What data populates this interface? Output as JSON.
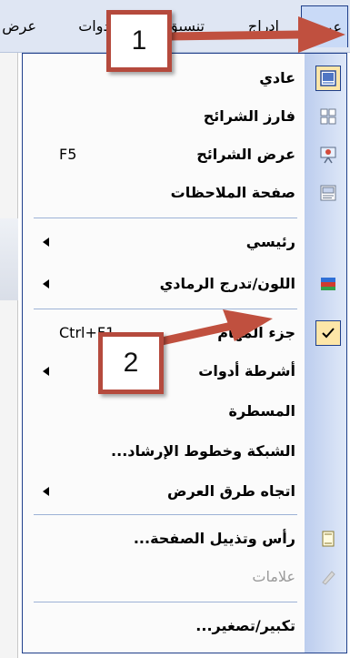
{
  "menubar": {
    "items": [
      {
        "label": "عرض"
      },
      {
        "label": "إدراج"
      },
      {
        "label": "تنسيق"
      },
      {
        "label": "أدوات"
      },
      {
        "label": "عرض"
      }
    ]
  },
  "menu": {
    "items": [
      {
        "label": "عادي",
        "shortcut": "",
        "submenu": false,
        "icon": "normal-view-icon"
      },
      {
        "label": "فارز الشرائح",
        "shortcut": "",
        "submenu": false,
        "icon": "slide-sorter-icon"
      },
      {
        "label": "عرض الشرائح",
        "shortcut": "F5",
        "submenu": false,
        "icon": "slide-show-icon"
      },
      {
        "label": "صفحة الملاحظات",
        "shortcut": "",
        "submenu": false,
        "icon": "notes-page-icon"
      },
      {
        "label": "رئيسي",
        "shortcut": "",
        "submenu": true,
        "icon": ""
      },
      {
        "label": "اللون/تدرج الرمادي",
        "shortcut": "",
        "submenu": true,
        "icon": "color-grayscale-icon"
      },
      {
        "label": "جزء المهام",
        "shortcut": "Ctrl+F1",
        "submenu": false,
        "icon": "check-icon"
      },
      {
        "label": "أشرطة أدوات",
        "shortcut": "",
        "submenu": true,
        "icon": ""
      },
      {
        "label": "المسطرة",
        "shortcut": "",
        "submenu": false,
        "icon": ""
      },
      {
        "label": "الشبكة وخطوط الإرشاد...",
        "shortcut": "",
        "submenu": false,
        "icon": ""
      },
      {
        "label": "اتجاه طرق العرض",
        "shortcut": "",
        "submenu": true,
        "icon": ""
      },
      {
        "label": "رأس وتذييل الصفحة...",
        "shortcut": "",
        "submenu": false,
        "icon": "header-footer-icon"
      },
      {
        "label": "علامات",
        "shortcut": "",
        "submenu": false,
        "icon": "markup-icon",
        "disabled": true
      },
      {
        "label": "تكبير/تصغير...",
        "shortcut": "",
        "submenu": false,
        "icon": ""
      }
    ]
  },
  "callouts": [
    {
      "label": "1"
    },
    {
      "label": "2"
    }
  ],
  "colors": {
    "accent": "#1f3f8a",
    "callout_border": "#b54a3d",
    "icon_strip": "#c9d8f2"
  }
}
